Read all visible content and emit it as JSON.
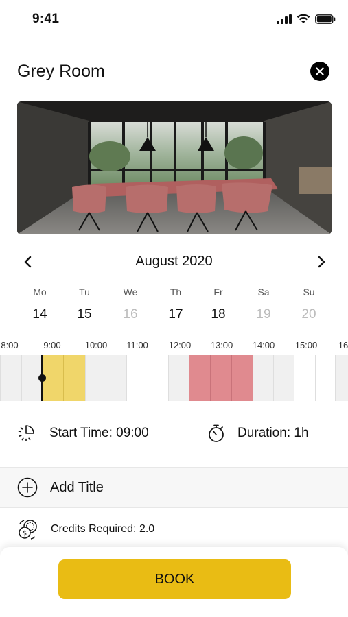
{
  "status_bar": {
    "time": "9:41"
  },
  "header": {
    "title": "Grey Room"
  },
  "calendar": {
    "month_label": "August 2020",
    "days": [
      {
        "name": "Mo",
        "number": "14"
      },
      {
        "name": "Tu",
        "number": "15"
      },
      {
        "name": "We",
        "number": "16"
      },
      {
        "name": "Th",
        "number": "17"
      },
      {
        "name": "Fr",
        "number": "18"
      },
      {
        "name": "Sa",
        "number": "19"
      },
      {
        "name": "Su",
        "number": "20"
      }
    ]
  },
  "timeline": {
    "hours": [
      "8:00",
      "9:00",
      "10:00",
      "11:00",
      "12:00",
      "13:00",
      "14:00",
      "15:00",
      "16"
    ]
  },
  "booking": {
    "start_time_label": "Start Time: 09:00",
    "duration_label": "Duration: 1h",
    "add_title_label": "Add Title",
    "credits_label": "Credits Required: 2.0",
    "book_label": "BOOK"
  },
  "colors": {
    "accent": "#e9bc14",
    "selected_slot": "#f0d66a",
    "booked_slot": "#e08a8f"
  }
}
